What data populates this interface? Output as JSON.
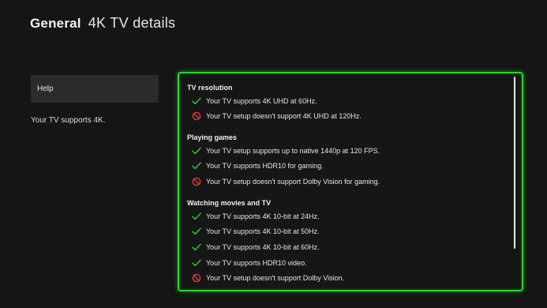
{
  "header": {
    "section": "General",
    "page": "4K TV details"
  },
  "sidebar": {
    "help_label": "Help",
    "summary": "Your TV supports 4K."
  },
  "colors": {
    "accent": "#27d827",
    "check": "#2fd32f",
    "block": "#e23b3b"
  },
  "groups": [
    {
      "title": "TV resolution",
      "items": [
        {
          "status": "check",
          "text": "Your TV supports 4K UHD at 60Hz."
        },
        {
          "status": "block",
          "text": "Your TV setup doesn't support 4K UHD at 120Hz."
        }
      ]
    },
    {
      "title": "Playing games",
      "items": [
        {
          "status": "check",
          "text": "Your TV setup supports up to native 1440p at 120 FPS."
        },
        {
          "status": "check",
          "text": "Your TV supports HDR10 for gaming."
        },
        {
          "status": "block",
          "text": "Your TV setup doesn't support Dolby Vision for gaming."
        }
      ]
    },
    {
      "title": "Watching movies and TV",
      "items": [
        {
          "status": "check",
          "text": "Your TV supports 4K 10-bit at 24Hz."
        },
        {
          "status": "check",
          "text": "Your TV supports 4K 10-bit at 50Hz."
        },
        {
          "status": "check",
          "text": "Your TV supports 4K 10-bit at 60Hz."
        },
        {
          "status": "check",
          "text": "Your TV supports HDR10 video."
        },
        {
          "status": "block",
          "text": "Your TV setup doesn't support Dolby Vision."
        }
      ]
    }
  ]
}
